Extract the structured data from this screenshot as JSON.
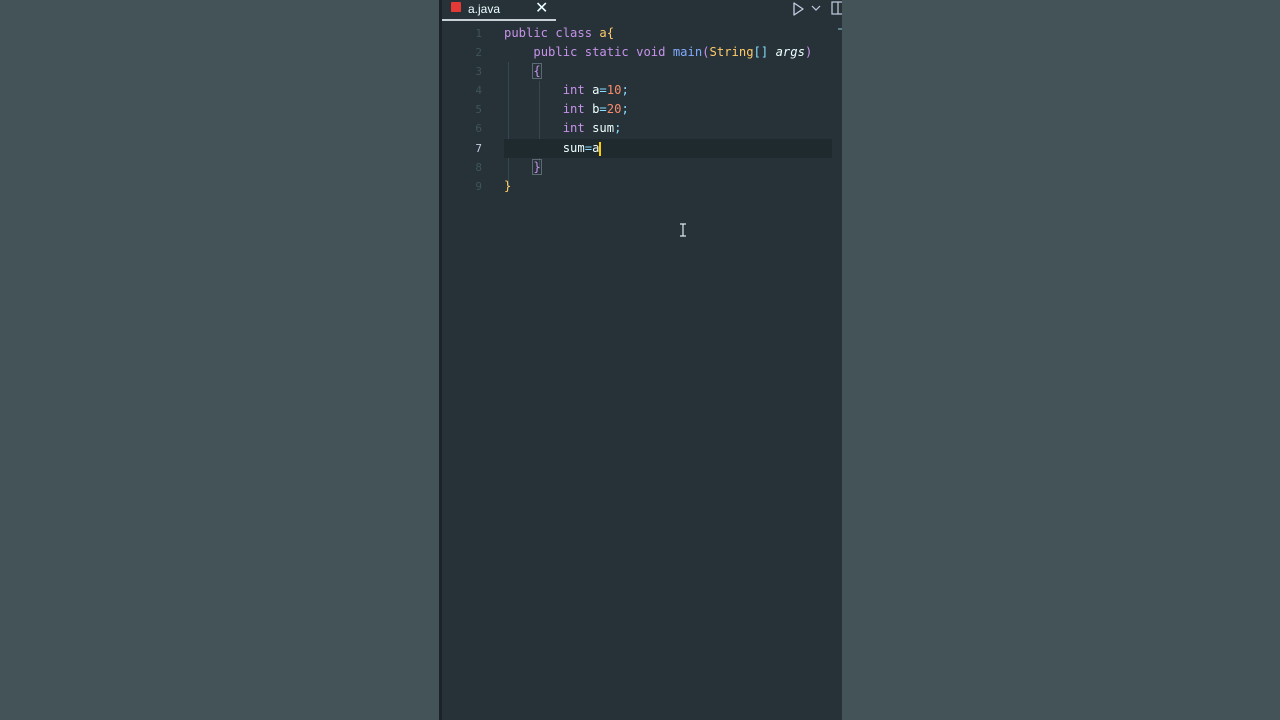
{
  "tab": {
    "filename": "a.java",
    "close_glyph": "✕",
    "icon": "java-file-icon"
  },
  "toolbar": {
    "run_icon": "play-icon",
    "run_dropdown_icon": "chevron-down-icon",
    "split_icon": "split-editor-icon"
  },
  "colors": {
    "background": "#435358",
    "editor_bg": "#263238",
    "keyword": "#c792ea",
    "class_name": "#ffcb6b",
    "function": "#82aaff",
    "number": "#f78c6c",
    "caret": "#ffcc00"
  },
  "code": {
    "line_numbers": [
      "1",
      "2",
      "3",
      "4",
      "5",
      "6",
      "7",
      "8",
      "9"
    ],
    "current_line": "7",
    "l1": {
      "kw1": "public",
      "kw2": "class",
      "name": "a",
      "brace": "{"
    },
    "l2": {
      "kw1": "public",
      "kw2": "static",
      "kw3": "void",
      "fn": "main",
      "open": "(",
      "type": "String",
      "brackets": "[]",
      "param": "args",
      "close": ")"
    },
    "l3": {
      "brace": "{"
    },
    "l4": {
      "kw": "int",
      "var": "a",
      "eq": "=",
      "num": "10",
      "semi": ";"
    },
    "l5": {
      "kw": "int",
      "var": "b",
      "eq": "=",
      "num": "20",
      "semi": ";"
    },
    "l6": {
      "kw": "int",
      "var": "sum",
      "semi": ";"
    },
    "l7": {
      "var": "sum",
      "eq": "=",
      "rhs": "a"
    },
    "l8": {
      "brace": "}"
    },
    "l9": {
      "brace": "}"
    }
  }
}
